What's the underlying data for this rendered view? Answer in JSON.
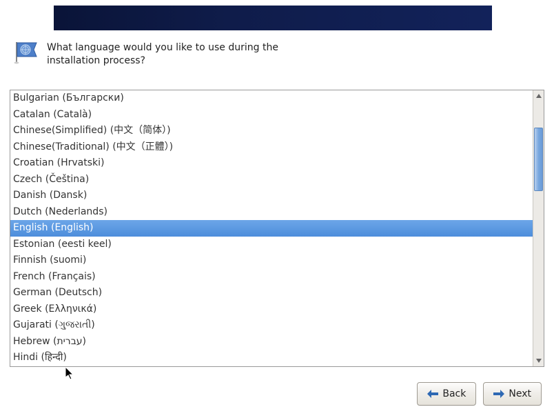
{
  "prompt": "What language would you like to use during the installation process?",
  "languages": [
    {
      "label": "Bulgarian (Български)",
      "selected": false
    },
    {
      "label": "Catalan (Català)",
      "selected": false
    },
    {
      "label": "Chinese(Simplified) (中文（简体）)",
      "selected": false
    },
    {
      "label": "Chinese(Traditional) (中文（正體）)",
      "selected": false
    },
    {
      "label": "Croatian (Hrvatski)",
      "selected": false
    },
    {
      "label": "Czech (Čeština)",
      "selected": false
    },
    {
      "label": "Danish (Dansk)",
      "selected": false
    },
    {
      "label": "Dutch (Nederlands)",
      "selected": false
    },
    {
      "label": "English (English)",
      "selected": true
    },
    {
      "label": "Estonian (eesti keel)",
      "selected": false
    },
    {
      "label": "Finnish (suomi)",
      "selected": false
    },
    {
      "label": "French (Français)",
      "selected": false
    },
    {
      "label": "German (Deutsch)",
      "selected": false
    },
    {
      "label": "Greek (Ελληνικά)",
      "selected": false
    },
    {
      "label": "Gujarati (ગુજરાતી)",
      "selected": false
    },
    {
      "label": "Hebrew (עברית)",
      "selected": false
    },
    {
      "label": "Hindi (हिन्दी)",
      "selected": false
    }
  ],
  "buttons": {
    "back": "Back",
    "next": "Next"
  }
}
